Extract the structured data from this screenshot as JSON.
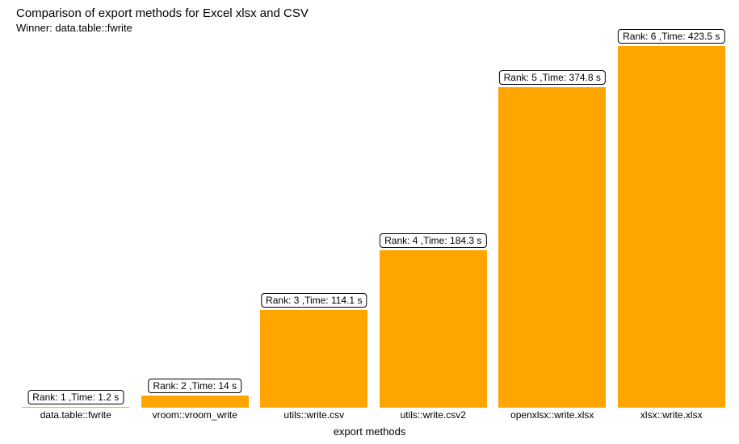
{
  "chart_data": {
    "type": "bar",
    "title": "Comparison of export methods for Excel xlsx and CSV",
    "subtitle": "Winner: data.table::fwrite",
    "xlabel": "export methods",
    "ylabel": "",
    "ylim": [
      0,
      430
    ],
    "categories": [
      "data.table::fwrite",
      "vroom::vroom_write",
      "utils::write.csv",
      "utils::write.csv2",
      "openxlsx::write.xlsx",
      "xlsx::write.xlsx"
    ],
    "values": [
      1.2,
      14,
      114.1,
      184.3,
      374.8,
      423.5
    ],
    "bar_labels": [
      "Rank: 1 ,Time: 1.2 s",
      "Rank: 2 ,Time: 14 s",
      "Rank: 3 ,Time: 114.1 s",
      "Rank: 4 ,Time: 184.3 s",
      "Rank: 5 ,Time: 374.8 s",
      "Rank: 6 ,Time: 423.5 s"
    ],
    "bar_color": "#ffa500"
  }
}
